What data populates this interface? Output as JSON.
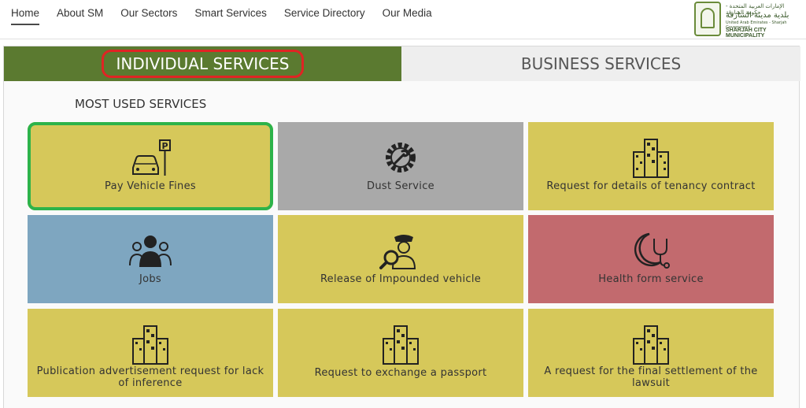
{
  "nav": {
    "items": [
      "Home",
      "About SM",
      "Our Sectors",
      "Smart Services",
      "Service Directory",
      "Our Media"
    ]
  },
  "logo": {
    "line1": "الإمارات العربية المتحدة - حكومة الشارقة",
    "line2": "بلدية مدينة الشارقة",
    "line3": "United Arab Emirates - Sharjah Government",
    "line4": "SHARJAH CITY MUNICIPALITY"
  },
  "tabs": {
    "individual": "INDIVIDUAL SERVICES",
    "business": "BUSINESS SERVICES"
  },
  "section_title": "MOST USED SERVICES",
  "services": [
    {
      "label": "Pay Vehicle Fines",
      "icon": "parking-car-icon",
      "color": "#d6c85a"
    },
    {
      "label": "Dust Service",
      "icon": "gear-wrench-icon",
      "color": "#a9a9a9"
    },
    {
      "label": "Request for details of tenancy contract",
      "icon": "building-icon",
      "color": "#d6c85a"
    },
    {
      "label": "Jobs",
      "icon": "people-icon",
      "color": "#7ea6c0"
    },
    {
      "label": "Release of Impounded vehicle",
      "icon": "officer-magnifier-icon",
      "color": "#d6c85a"
    },
    {
      "label": "Health form service",
      "icon": "moon-stethoscope-icon",
      "color": "#c26a6e"
    },
    {
      "label": "Publication advertisement request for lack of inference",
      "icon": "building-icon",
      "color": "#d6c85a"
    },
    {
      "label": "Request to exchange a passport",
      "icon": "building-icon",
      "color": "#d6c85a"
    },
    {
      "label": "A request for the final settlement of the lawsuit",
      "icon": "building-icon",
      "color": "#d6c85a"
    }
  ],
  "colors": {
    "active_tab": "#5b7a30",
    "highlight_green": "#2db34a",
    "highlight_red": "#e02424"
  }
}
